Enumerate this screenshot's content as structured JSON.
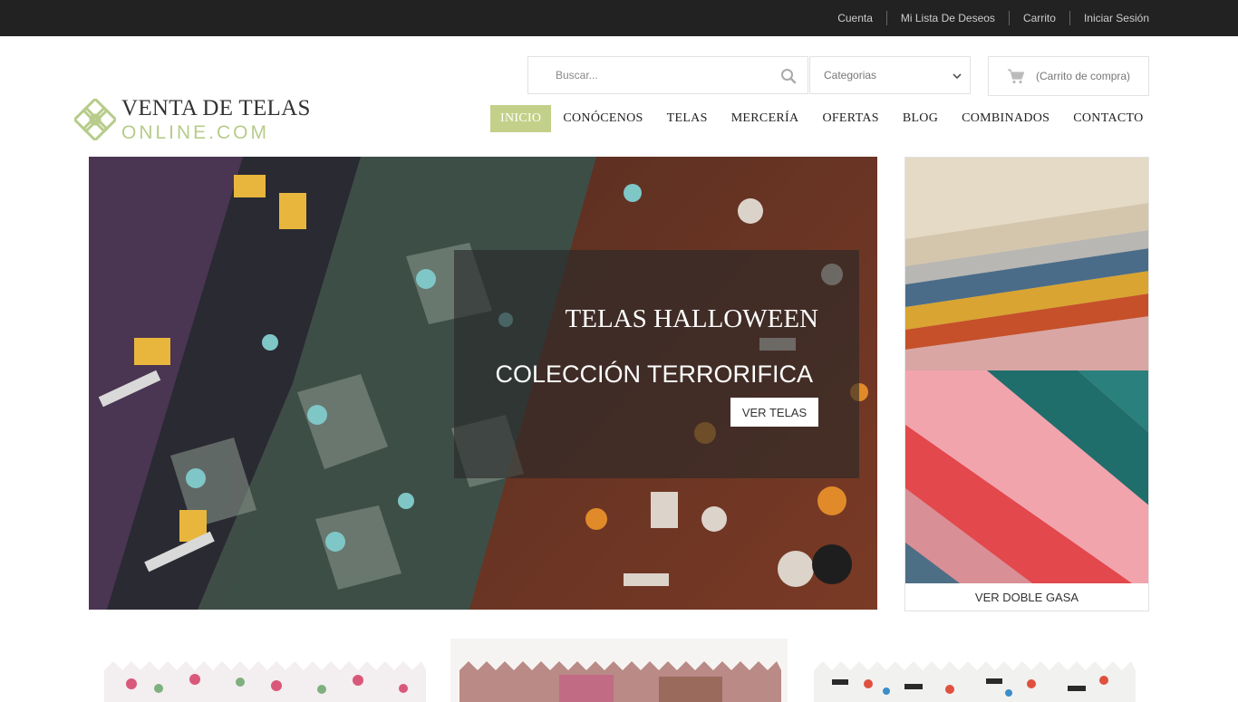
{
  "topbar": {
    "links": [
      {
        "label": "Cuenta"
      },
      {
        "label": "Mi Lista De Deseos"
      },
      {
        "label": "Carrito"
      },
      {
        "label": "Iniciar Sesión"
      }
    ]
  },
  "logo": {
    "line1": "VENTA DE TELAS",
    "line2": "ONLINE.COM"
  },
  "search": {
    "placeholder": "Buscar...",
    "icon": "search-icon"
  },
  "categories": {
    "selected": "Categorias",
    "icon": "chevron-down-icon"
  },
  "cart": {
    "label": "(Carrito de compra)",
    "icon": "cart-icon"
  },
  "nav": {
    "items": [
      {
        "label": "INICIO"
      },
      {
        "label": "CONÓCENOS"
      },
      {
        "label": "TELAS"
      },
      {
        "label": "MERCERÍA"
      },
      {
        "label": "OFERTAS"
      },
      {
        "label": "BLOG"
      },
      {
        "label": "COMBINADOS"
      },
      {
        "label": "CONTACTO"
      }
    ],
    "active_color": "#c3d089"
  },
  "hero": {
    "title": "TELAS HALLOWEEN",
    "subtitle": "COLECCIÓN TERRORIFICA",
    "button": "VER TELAS"
  },
  "side_banner": {
    "link": "VER DOBLE GASA"
  },
  "colors": {
    "topbar_bg": "#222222",
    "brand_green": "#b8cc8a"
  }
}
